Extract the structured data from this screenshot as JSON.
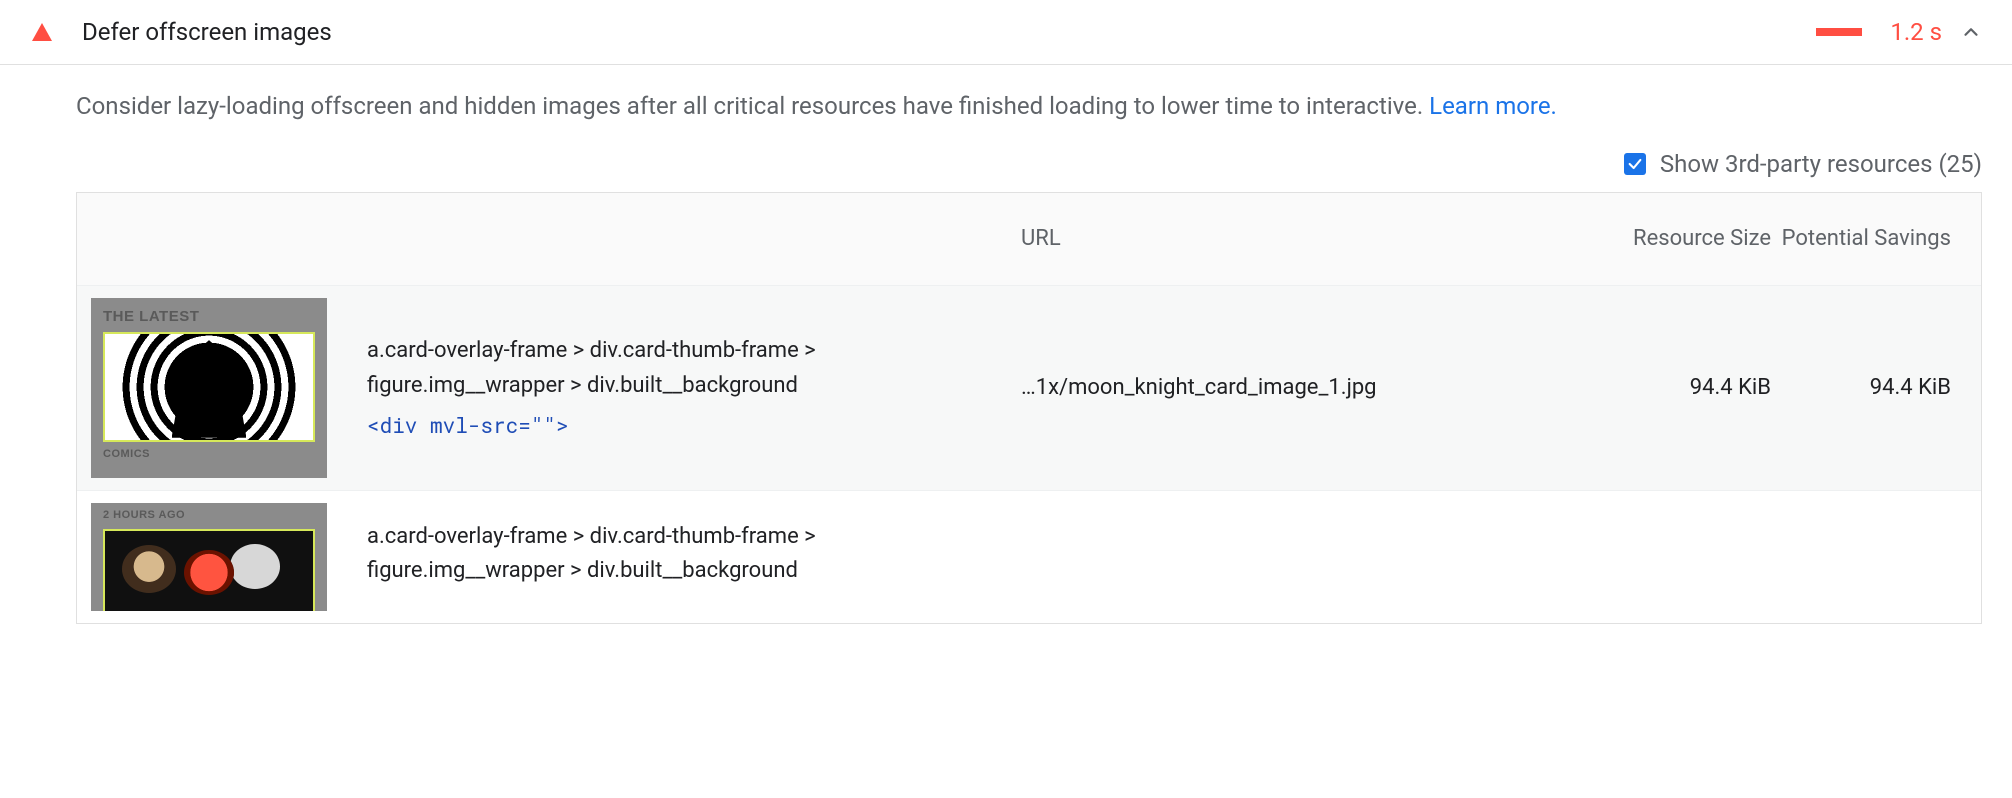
{
  "audit": {
    "title": "Defer offscreen images",
    "metric_time": "1.2 s",
    "description": "Consider lazy-loading offscreen and hidden images after all critical resources have finished loading to lower time to interactive. ",
    "learn_more": "Learn more."
  },
  "third_party": {
    "label": "Show 3rd-party resources (25)",
    "checked": true
  },
  "table": {
    "headers": {
      "url": "URL",
      "resource_size": "Resource Size",
      "potential_savings": "Potential Savings"
    },
    "rows": [
      {
        "thumb_tag_top": "THE LATEST",
        "thumb_tag_bottom": "COMICS",
        "selector": "a.card-overlay-frame > div.card-thumb-frame > figure.img__wrapper > div.built__background",
        "dom_snippet": "<div mvl-src=\"\">",
        "url": "…1x/moon_knight_card_image_1.jpg",
        "resource_size": "94.4 KiB",
        "potential_savings": "94.4 KiB"
      },
      {
        "thumb_tag_top": "2 HOURS AGO",
        "thumb_tag_bottom": "",
        "selector": "a.card-overlay-frame > div.card-thumb-frame > figure.img__wrapper > div.built__background",
        "dom_snippet": "",
        "url": "",
        "resource_size": "",
        "potential_savings": ""
      }
    ]
  }
}
